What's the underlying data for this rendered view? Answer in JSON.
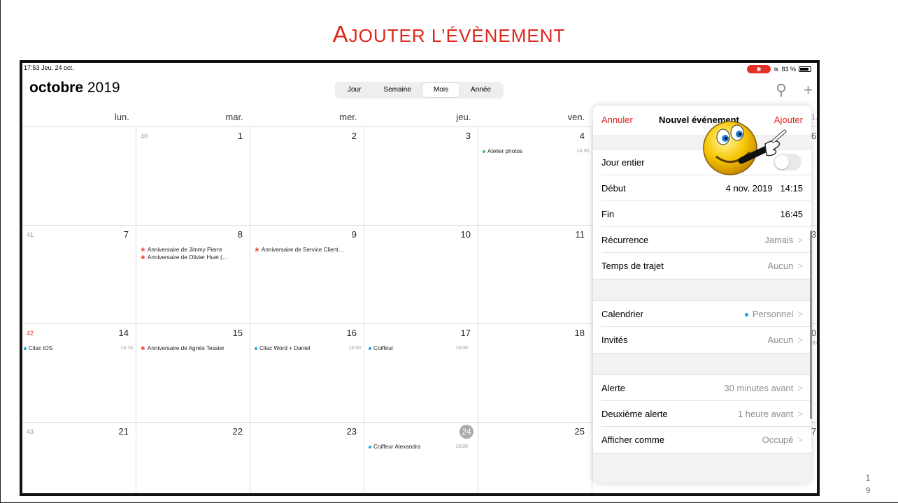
{
  "slide": {
    "title_first": "A",
    "title_rest": "JOUTER L’ÉVÈNEMENT",
    "page_number_line1": "1",
    "page_number_line2": "9"
  },
  "status_bar": {
    "time_date": "17:53  Jeu. 24 oct.",
    "battery": "83 %"
  },
  "calendar": {
    "month": "octobre",
    "year": "2019",
    "view_tabs": [
      "Jour",
      "Semaine",
      "Mois",
      "Année"
    ],
    "active_view": "Mois",
    "weekdays": [
      "lun.",
      "mar.",
      "mer.",
      "jeu.",
      "ven."
    ],
    "weeks": [
      {
        "week_number": "40",
        "days": [
          "",
          "1",
          "2",
          "3",
          "4"
        ]
      },
      {
        "week_number": "41",
        "days": [
          "7",
          "8",
          "9",
          "10",
          "11"
        ]
      },
      {
        "week_number": "42",
        "days": [
          "14",
          "15",
          "16",
          "17",
          "18"
        ]
      },
      {
        "week_number": "43",
        "days": [
          "21",
          "22",
          "23",
          "24",
          "25"
        ]
      }
    ],
    "today": "24",
    "events": {
      "atelier": {
        "title": "Atelier photos",
        "time": "14:30"
      },
      "anniv_jimmy": "Anniversaire de Jimmy Pierre",
      "anniv_olivier": "Anniversaire de Olivier Huet (…",
      "anniv_service": "Anniversaire de Service Client…",
      "cilac_ios": {
        "title": "Cilac iOS",
        "time": "14:15"
      },
      "anniv_agnes": "Anniversaire de Agnès Tessier",
      "cilac_word": {
        "title": "Cilac Word + Daniel",
        "time": "14:00"
      },
      "coiffeur": {
        "title": "Coiffeur",
        "time": "10:00"
      },
      "coiffeur_alex": {
        "title": "Coiffeur Alexandra",
        "time": "10:00"
      }
    },
    "clipped_right": [
      "1.",
      "6",
      "3",
      "0",
      "00",
      "7"
    ]
  },
  "new_event": {
    "cancel": "Annuler",
    "title": "Nouvel événement",
    "add": "Ajouter",
    "all_day_label": "Jour entier",
    "all_day_on": false,
    "start_label": "Début",
    "start_date": "4 nov. 2019",
    "start_time": "14:15",
    "end_label": "Fin",
    "end_time": "16:45",
    "repeat_label": "Récurrence",
    "repeat_value": "Jamais",
    "travel_label": "Temps de trajet",
    "travel_value": "Aucun",
    "calendar_label": "Calendrier",
    "calendar_value": "Personnel",
    "invitees_label": "Invités",
    "invitees_value": "Aucun",
    "alert_label": "Alerte",
    "alert_value": "30 minutes avant",
    "second_alert_label": "Deuxième alerte",
    "second_alert_value": "1 heure avant",
    "show_as_label": "Afficher comme",
    "show_as_value": "Occupé"
  },
  "colors": {
    "accent_red": "#e0261b",
    "calendar_blue": "#1aa3e8",
    "event_green": "#34c759"
  }
}
